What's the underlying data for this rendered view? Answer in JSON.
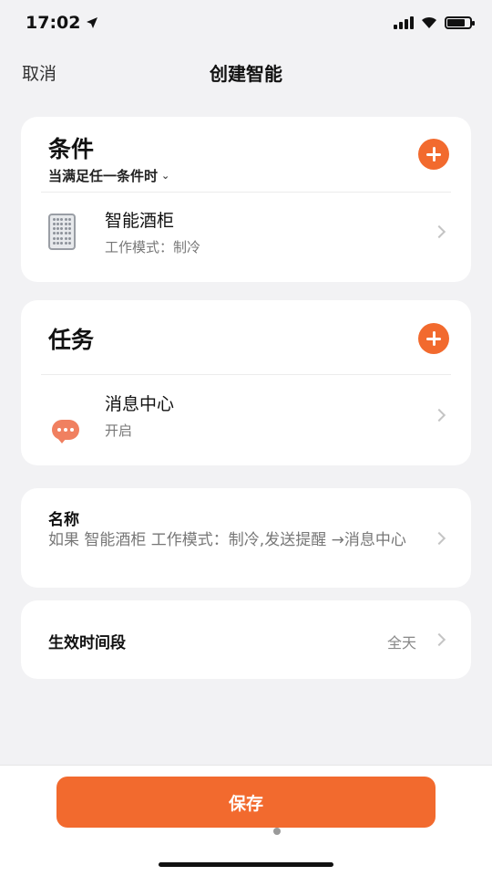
{
  "status_bar": {
    "time": "17:02",
    "location_icon": "location-arrow-icon",
    "signal_icon": "cellular-signal-icon",
    "wifi_icon": "wifi-icon",
    "battery_icon": "battery-icon"
  },
  "nav": {
    "cancel_label": "取消",
    "title": "创建智能"
  },
  "conditions": {
    "title": "条件",
    "subtitle": "当满足任一条件时",
    "add_icon": "plus-icon",
    "items": [
      {
        "title": "智能酒柜",
        "subtitle": "工作模式：制冷",
        "icon": "wine-cabinet-icon"
      }
    ]
  },
  "tasks": {
    "title": "任务",
    "add_icon": "plus-icon",
    "items": [
      {
        "title": "消息中心",
        "subtitle": "开启",
        "icon": "message-bubble-icon"
      }
    ]
  },
  "name": {
    "label": "名称",
    "value": "如果 智能酒柜 工作模式：制冷,发送提醒 →消息中心"
  },
  "effective_period": {
    "label": "生效时间段",
    "value": "全天"
  },
  "footer": {
    "save_label": "保存"
  },
  "colors": {
    "accent": "#f26a2e",
    "background": "#f2f2f4",
    "card": "#ffffff"
  }
}
